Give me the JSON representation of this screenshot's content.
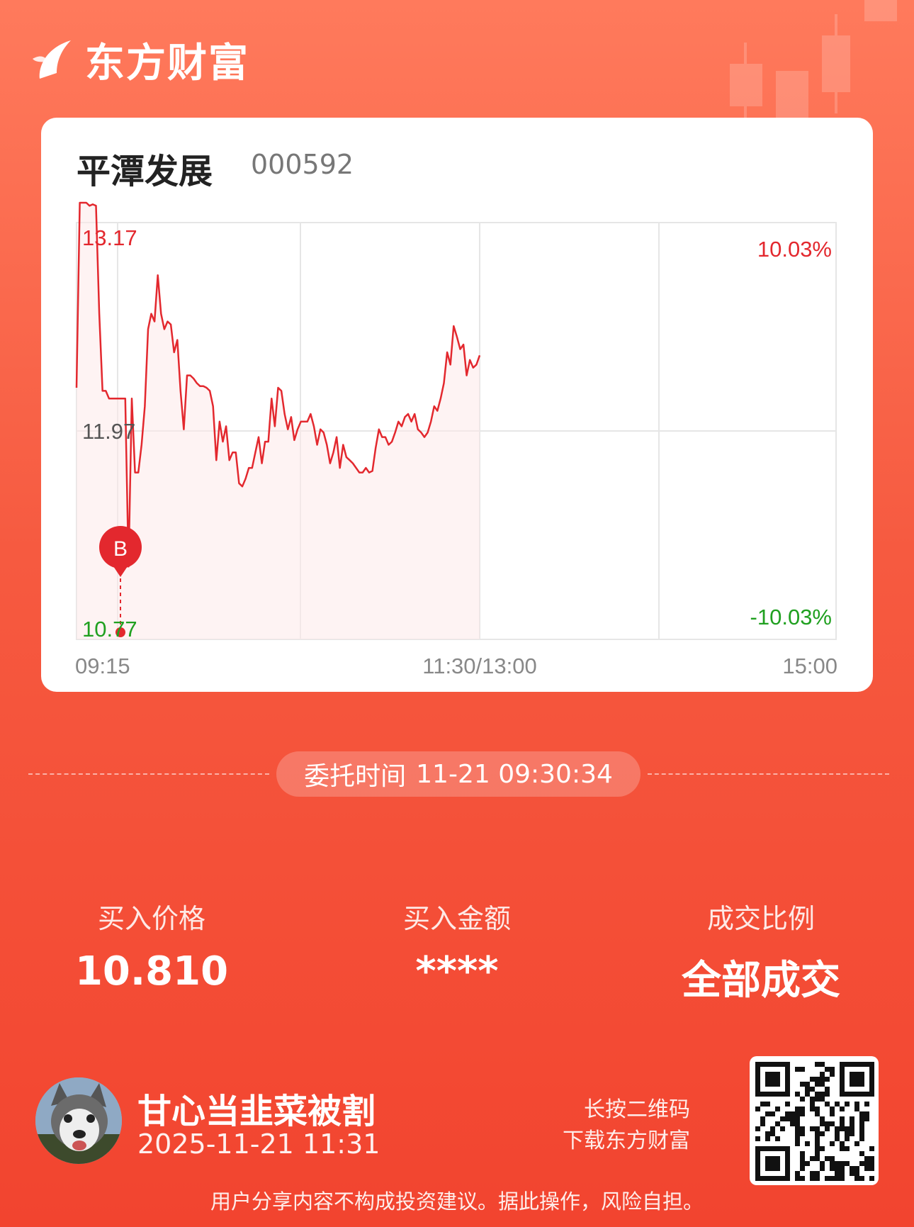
{
  "brand": {
    "name": "东方财富",
    "icon": "sail-logo-icon"
  },
  "stock": {
    "name": "平潭发展",
    "code": "000592"
  },
  "chart_data": {
    "type": "line",
    "price_max": "13.17",
    "price_prev_close": "11.97",
    "price_min": "10.77",
    "pct_max": "10.03%",
    "pct_min": "-10.03%",
    "x_ticks": [
      "09:15",
      "11:30/13:00",
      "15:00"
    ],
    "ylim": [
      10.77,
      13.17
    ],
    "series": [
      {
        "values": [
          11.97,
          13.17,
          13.17,
          13.17,
          13.15,
          13.16,
          13.15,
          12.45,
          11.95,
          11.95,
          11.9,
          11.9,
          11.9,
          11.9,
          11.9,
          11.9,
          10.81,
          11.9,
          11.42,
          11.42,
          11.6,
          11.85,
          12.35,
          12.45,
          12.4,
          12.7,
          12.45,
          12.35,
          12.4,
          12.38,
          12.2,
          12.28,
          11.95,
          11.7,
          12.05,
          12.05,
          12.03,
          12.0,
          11.98,
          11.98,
          11.97,
          11.95,
          11.85,
          11.5,
          11.75,
          11.62,
          11.72,
          11.5,
          11.55,
          11.55,
          11.35,
          11.33,
          11.38,
          11.45,
          11.45,
          11.55,
          11.65,
          11.48,
          11.62,
          11.62,
          11.9,
          11.72,
          11.97,
          11.95,
          11.8,
          11.7,
          11.78,
          11.63,
          11.7,
          11.75,
          11.75,
          11.75,
          11.8,
          11.72,
          11.6,
          11.7,
          11.68,
          11.6,
          11.48,
          11.55,
          11.65,
          11.45,
          11.6,
          11.52,
          11.5,
          11.48,
          11.45,
          11.42,
          11.42,
          11.45,
          11.42,
          11.43,
          11.58,
          11.7,
          11.65,
          11.65,
          11.6,
          11.62,
          11.68,
          11.75,
          11.72,
          11.78,
          11.8,
          11.75,
          11.8,
          11.7,
          11.68,
          11.65,
          11.68,
          11.75,
          11.85,
          11.82,
          11.9,
          12.0,
          12.2,
          12.12,
          12.37,
          12.3,
          12.22,
          12.25,
          12.05,
          12.15,
          12.1,
          12.12,
          12.18
        ]
      }
    ],
    "buy_marker": {
      "label": "B",
      "price": "10.81"
    }
  },
  "order": {
    "label": "委托时间",
    "time": "11-21 09:30:34"
  },
  "stats": [
    {
      "label": "买入价格",
      "value": "10.810"
    },
    {
      "label": "买入金额",
      "value": "****"
    },
    {
      "label": "成交比例",
      "value": "全部成交"
    }
  ],
  "user": {
    "name": "甘心当韭菜被割",
    "time": "2025-11-21 11:31",
    "avatar": "husky-dog-avatar"
  },
  "qr": {
    "hint_line1": "长按二维码",
    "hint_line2": "下载东方财富"
  },
  "disclaimer": "用户分享内容不构成投资建议。据此操作，风险自担。",
  "colors": {
    "up": "#e3282e",
    "down": "#20a020",
    "bg_top": "#ff7a5c",
    "bg_bottom": "#f2442f"
  }
}
